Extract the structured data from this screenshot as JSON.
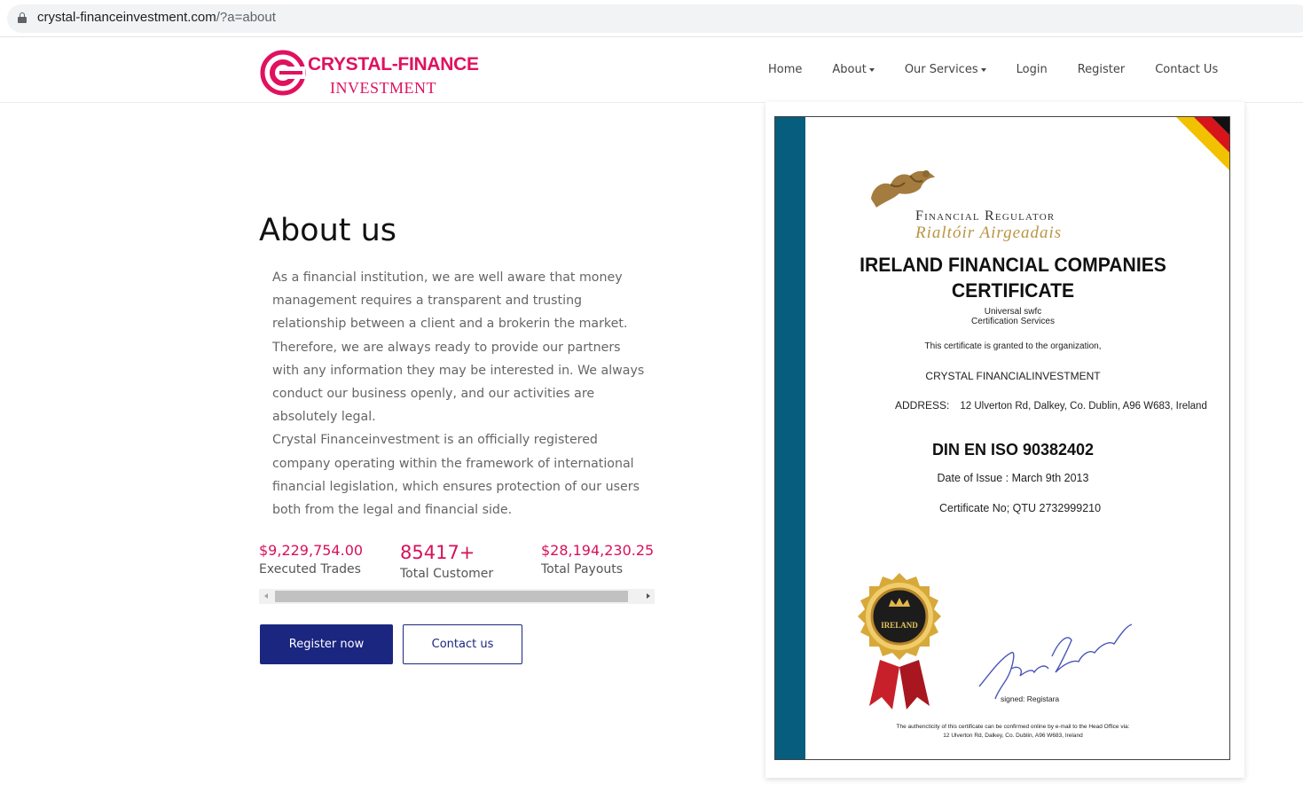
{
  "browser": {
    "url_host": "crystal-financeinvestment.com",
    "url_path": "/?a=about"
  },
  "brand": {
    "name_line1": "CRYSTAL-FINANCE",
    "name_line2": "INVESTMENT",
    "color": "#e0115f"
  },
  "nav": {
    "home": "Home",
    "about": "About",
    "services": "Our Services",
    "login": "Login",
    "register": "Register",
    "contact": "Contact Us"
  },
  "about": {
    "title": "About us",
    "paragraph1": "As a financial institution, we are well aware that money management requires a transparent and trusting relationship between a client and a brokerin the market. Therefore, we are always ready to provide our partners with any information they may be interested in. We always conduct our business openly, and our activities are absolutely legal.",
    "paragraph2": "Crystal Financeinvestment is an officially registered company operating within the framework of international financial legislation, which ensures protection of our users both from the legal and financial side."
  },
  "stats": [
    {
      "value": "$9,229,754.00",
      "label": "Executed Trades"
    },
    {
      "value": "85417+",
      "label": "Total Customer"
    },
    {
      "value": "$28,194,230.25",
      "label": "Total Payouts"
    }
  ],
  "buttons": {
    "register": "Register now",
    "contact": "Contact us"
  },
  "certificate": {
    "regulator_en": "Financial Regulator",
    "regulator_ga": "Rialtóir Airgeadais",
    "title_line1": "IRELAND FINANCIAL COMPANIES",
    "title_line2": "CERTIFICATE",
    "univ_line1": "Universal swfc",
    "univ_line2": "Certification Services",
    "granted": "This certificate is granted to the organization,",
    "org": "CRYSTAL FINANCIALINVESTMENT",
    "address_label": "ADDRESS:",
    "address": "12 Ulverton Rd, Dalkey, Co. Dublin, A96 W683, Ireland",
    "iso": "DIN EN ISO 90382402",
    "date": "Date of Issue :  March 9th 2013",
    "cert_no": "Certificate No; QTU 2732999210",
    "seal_text": "IRELAND",
    "signed": "signed: Registara",
    "foot_line1": "The authencticity of this certificate can be confirmed online by e-mail to the Head Office via:",
    "foot_line2": "12 Ulverton Rd, Dalkey, Co. Dublin, A96 W683, Ireland",
    "band_color": "#065d7e"
  }
}
